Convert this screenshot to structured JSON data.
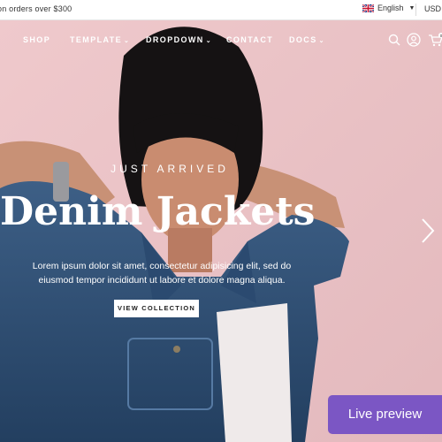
{
  "topbar": {
    "promo": "on orders over $300",
    "language": "English",
    "currency": "USD"
  },
  "nav": {
    "items": [
      "SHOP",
      "TEMPLATE",
      "DROPDOWN",
      "CONTACT",
      "DOCS"
    ],
    "cart_count": "0"
  },
  "hero": {
    "subtitle": "JUST ARRIVED",
    "title": "Denim Jackets",
    "description": "Lorem ipsum dolor sit amet, consectetur adipisicing elit, sed do eiusmod tempor incididunt ut labore et dolore magna aliqua.",
    "cta": "VIEW COLLECTION"
  },
  "live_preview": "Live preview",
  "colors": {
    "background": "#eac8cb",
    "accent": "#7b56c4"
  }
}
